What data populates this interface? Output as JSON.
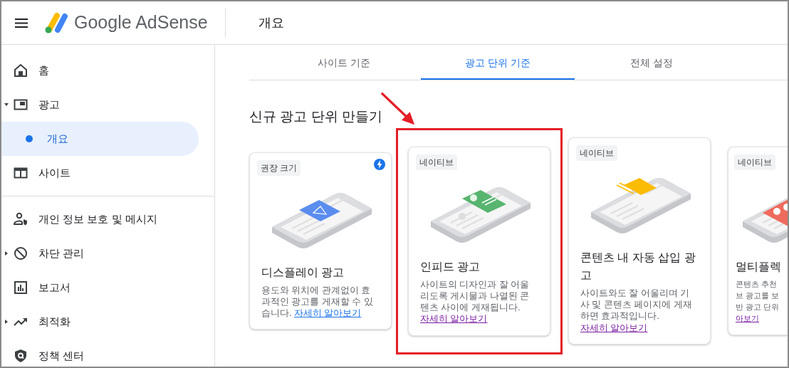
{
  "header": {
    "product": "Google AdSense",
    "page_title": "개요"
  },
  "sidebar": {
    "groups": [
      {
        "items": [
          {
            "label": "홈",
            "selected": false
          },
          {
            "label": "광고",
            "selected": false,
            "expanded": true,
            "children": [
              {
                "label": "개요",
                "selected": true
              }
            ]
          },
          {
            "label": "사이트",
            "selected": false
          }
        ]
      },
      {
        "items": [
          {
            "label": "개인 정보 보호 및 메시지",
            "selected": false
          },
          {
            "label": "차단 관리",
            "selected": false,
            "expanded": false
          },
          {
            "label": "보고서",
            "selected": false
          },
          {
            "label": "최적화",
            "selected": false,
            "expanded": false
          },
          {
            "label": "정책 센터",
            "selected": false
          }
        ]
      }
    ]
  },
  "tabs": [
    {
      "label": "사이트 기준",
      "selected": false
    },
    {
      "label": "광고 단위 기준",
      "selected": true
    },
    {
      "label": "전체 설정",
      "selected": false
    }
  ],
  "section_title": "신규 광고 단위 만들기",
  "cards": [
    {
      "kind": "display",
      "badge": "권장 크기",
      "amp": true,
      "highlighted": false,
      "title": "디스플레이 광고",
      "description": "용도와 위치에 관계없이 효과적인 광고를 게재할 수 있습니다.",
      "link": {
        "label": "자세히 알아보기",
        "visited": false
      }
    },
    {
      "kind": "infeed",
      "badge": "네이티브",
      "amp": false,
      "highlighted": true,
      "title": "인피드 광고",
      "description": "사이트의 디자인과 잘 어울리도록 게시물과 나열된 콘텐츠 사이에 게재됩니다.",
      "link": {
        "label": "자세히 알아보기",
        "visited": true
      }
    },
    {
      "kind": "inarticle",
      "badge": "네이티브",
      "amp": false,
      "highlighted": false,
      "title": "콘텐츠 내 자동 삽입 광고",
      "description": "사이트와도 잘 어울리며 기사 및 콘텐츠 페이지에 게재하면 효과적입니다.",
      "link": {
        "label": "자세히 알아보기",
        "visited": true
      }
    },
    {
      "kind": "multiplex",
      "badge": "네이티브",
      "amp": false,
      "highlighted": false,
      "title": "멀티플렉",
      "lines": [
        "콘텐츠 추천",
        "브 광고를 보",
        "반 광고 단위"
      ],
      "link": {
        "label": "아보기",
        "visited": true
      }
    }
  ]
}
